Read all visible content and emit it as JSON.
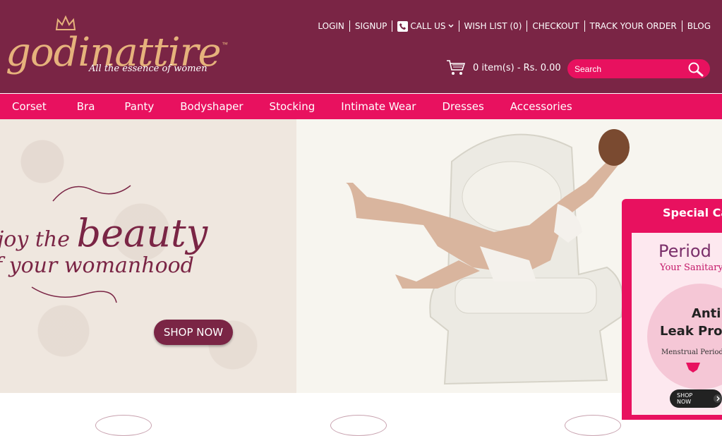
{
  "brand": {
    "name": "godinattire",
    "tm": "™",
    "tagline": "All the essence of women"
  },
  "toplinks": {
    "login": "LOGIN",
    "signup": "SIGNUP",
    "call_us": "CALL US",
    "wishlist": "WISH LIST (0)",
    "checkout": "CHECKOUT",
    "track": "TRACK YOUR ORDER",
    "blog": "BLOG"
  },
  "cart": {
    "summary": "0 item(s) - Rs. 0.00"
  },
  "search": {
    "placeholder": "Search"
  },
  "nav": {
    "items": [
      "Corset",
      "Bra",
      "Panty",
      "Bodyshaper",
      "Stocking",
      "Intimate Wear",
      "Dresses",
      "Accessories"
    ]
  },
  "banner": {
    "line1_a": "joy the ",
    "line1_b": "beauty",
    "line2": "f your womanhood",
    "shop_now": "SHOP NOW"
  },
  "special": {
    "title": "Special Car",
    "period": "Period",
    "sub": "Your Sanitary",
    "anti": "Anti",
    "leak": "Leak Prod",
    "menstrual": "Menstrual Period P",
    "shop_now": "SHOP NOW"
  },
  "colors": {
    "header": "#7a2545",
    "accent": "#e8115f",
    "gold": "#e6b27c"
  }
}
